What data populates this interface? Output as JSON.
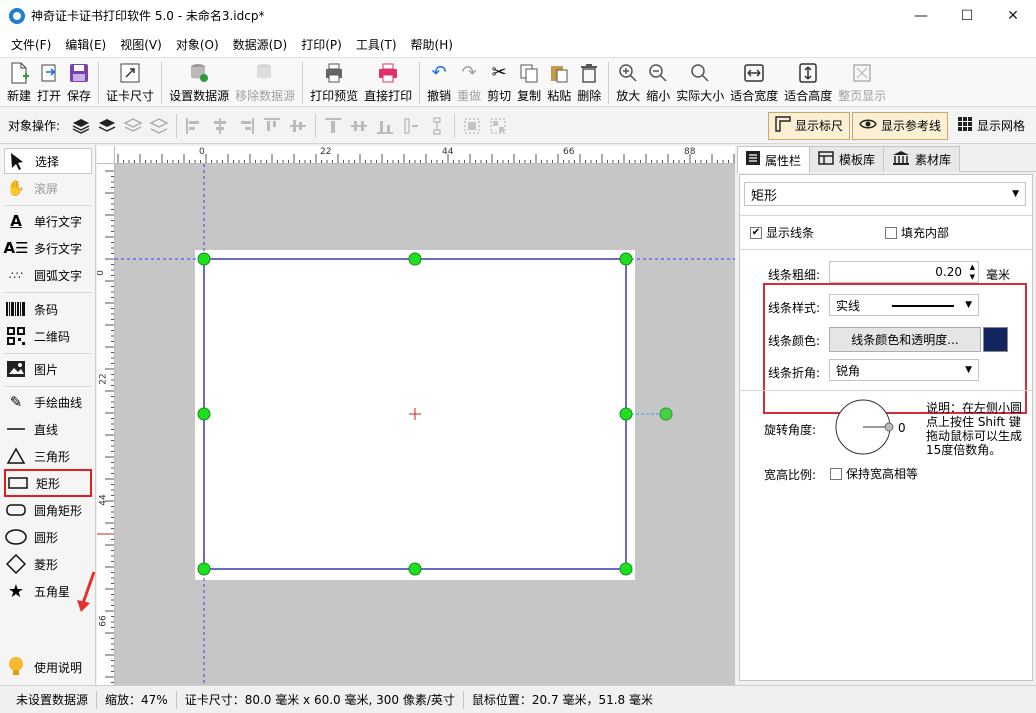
{
  "window": {
    "title": "神奇证卡证书打印软件 5.0 - 未命名3.idcp*",
    "minimize_glyph": "—",
    "maximize_glyph": "☐",
    "close_glyph": "✕"
  },
  "menu": [
    "文件(F)",
    "编辑(E)",
    "视图(V)",
    "对象(O)",
    "数据源(D)",
    "打印(P)",
    "工具(T)",
    "帮助(H)"
  ],
  "toolbar": {
    "new": "新建",
    "open": "打开",
    "save": "保存",
    "card_size": "证卡尺寸",
    "set_datasource": "设置数据源",
    "remove_datasource": "移除数据源",
    "print_preview": "打印预览",
    "direct_print": "直接打印",
    "undo": "撤销",
    "redo": "重做",
    "cut": "剪切",
    "copy": "复制",
    "paste": "粘贴",
    "delete": "删除",
    "zoom_in": "放大",
    "zoom_out": "缩小",
    "actual_size": "实际大小",
    "fit_width": "适合宽度",
    "fit_height": "适合高度",
    "whole_page": "整页显示"
  },
  "objbar": {
    "label": "对象操作:",
    "show_ruler": "显示标尺",
    "show_guides": "显示参考线",
    "show_grid": "显示网格"
  },
  "tools": {
    "select": "选择",
    "scroll": "滚屏",
    "single_text": "单行文字",
    "multi_text": "多行文字",
    "arc_text": "圆弧文字",
    "barcode": "条码",
    "qrcode": "二维码",
    "image": "图片",
    "freehand": "手绘曲线",
    "line": "直线",
    "triangle": "三角形",
    "rectangle": "矩形",
    "rounded_rect": "圆角矩形",
    "ellipse": "圆形",
    "diamond": "菱形",
    "star": "五角星",
    "help": "使用说明"
  },
  "rulers": {
    "h_ticks": [
      "0",
      "22",
      "44",
      "66",
      "88"
    ],
    "v_ticks": [
      "0",
      "22",
      "44",
      "66"
    ]
  },
  "panel": {
    "tabs": [
      "属性栏",
      "模板库",
      "素材库"
    ],
    "object_type": "矩形",
    "show_line": "显示线条",
    "fill_inside": "填充内部",
    "line_width_label": "线条粗细:",
    "line_width_value": "0.20",
    "line_width_unit": "毫米",
    "line_style_label": "线条样式:",
    "line_style_value": "实线",
    "line_color_label": "线条颜色:",
    "line_color_button": "线条颜色和透明度...",
    "line_color": "#12275f",
    "line_corner_label": "线条折角:",
    "line_corner_value": "锐角",
    "rotation_label": "旋转角度:",
    "rotation_value": "0",
    "rotation_help": "说明：在左侧小圆点上按住 Shift 键拖动鼠标可以生成15度倍数角。",
    "aspect_label": "宽高比例:",
    "keep_aspect": "保持宽高相等"
  },
  "status": {
    "datasource": "未设置数据源",
    "zoom": "缩放：47%",
    "card_size": "证卡尺寸：80.0 毫米 x 60.0 毫米, 300 像素/英寸",
    "mouse_pos": "鼠标位置：20.7 毫米，51.8 毫米"
  }
}
